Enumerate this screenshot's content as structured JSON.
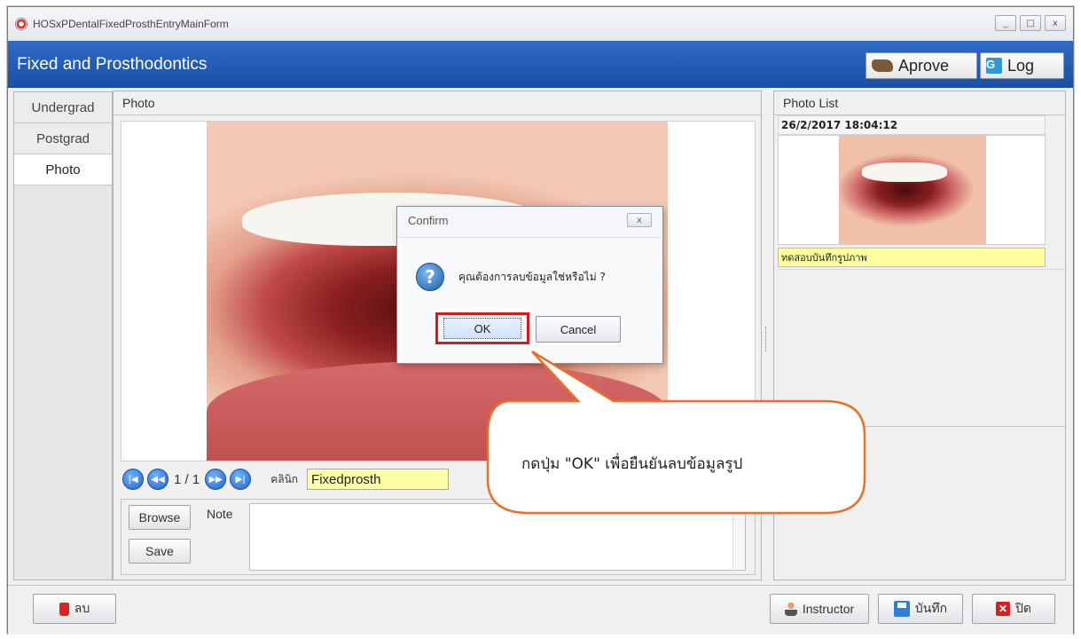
{
  "window": {
    "title": "HOSxPDentalFixedProsthEntryMainForm",
    "controls": [
      "_",
      "□",
      "x"
    ]
  },
  "header": {
    "title": "Fixed and Prosthodontics",
    "aprove_label": "Aprove",
    "log_label": "Log",
    "log_glyph": "G"
  },
  "sidetabs": [
    "Undergrad",
    "Postgrad",
    "Photo"
  ],
  "photo_panel": {
    "title": "Photo",
    "counter": "1 / 1",
    "clinic_label": "คลินิก",
    "clinic_value": "Fixedprosth",
    "browse_label": "Browse",
    "save_label": "Save",
    "note_label": "Note"
  },
  "photo_list": {
    "title": "Photo List",
    "date": "26/2/2017 18:04:12",
    "note": "ทดสอบบันทึกรูปภาพ"
  },
  "bottom": {
    "delete_label": "ลบ",
    "instructor_label": "Instructor",
    "save_label": "บันทึก",
    "close_label": "ปิด"
  },
  "dialog": {
    "title": "Confirm",
    "close_glyph": "x",
    "icon_glyph": "?",
    "message": "คุณต้องการลบข้อมูลใช่หรือไม่ ?",
    "ok_label": "OK",
    "cancel_label": "Cancel"
  },
  "callout": {
    "text": "กดปุ่ม \"OK\" เพื่อยืนยันลบข้อมูลรูป"
  },
  "colors": {
    "header_blue": "#1a4fa3",
    "highlight_red": "#d21c1c",
    "callout_border": "#e8702a",
    "note_yellow": "#ffffa8"
  }
}
